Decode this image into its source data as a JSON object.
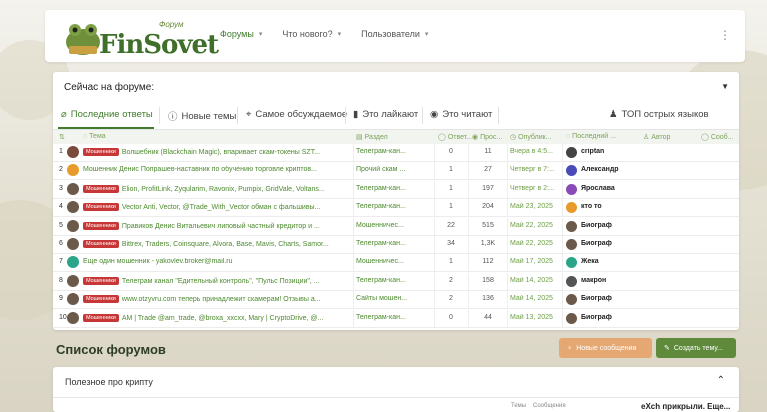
{
  "header": {
    "logo_text": "FinSovet",
    "logo_sub": "Форум",
    "nav": [
      {
        "label": "Форумы",
        "active": true
      },
      {
        "label": "Что нового?",
        "active": false
      },
      {
        "label": "Пользователи",
        "active": false
      }
    ],
    "menu_icon": "kebab-icon"
  },
  "now_on_forum": {
    "title": "Сейчас на форуме:",
    "tabs": [
      {
        "label": "Последние ответы",
        "icon": "reply-icon"
      },
      {
        "label": "Новые темы",
        "icon": "info-icon"
      },
      {
        "label": "Самое обсуждаемое",
        "icon": "megaphone-icon"
      },
      {
        "label": "Это лайкают",
        "icon": "like-icon"
      },
      {
        "label": "Это читают",
        "icon": "eye-icon"
      },
      {
        "label": "ТОП острых языков",
        "icon": "users-icon"
      }
    ],
    "columns": {
      "topic": "Тема",
      "section": "Раздел",
      "replies": "Ответ...",
      "views": "Прос...",
      "published": "Опублик...",
      "last": "Последний ...",
      "author": "Автор",
      "messages": "Сооб..."
    },
    "tag_label": "Мошенники",
    "rows": [
      {
        "n": "1",
        "tag": true,
        "title": "Волшебник (Blackchain Magic), впаривает скам-токены SZT...",
        "section": "Телеграм-кан...",
        "replies": "0",
        "views": "11",
        "pub": "Вчера в 4:5...",
        "last": "criptan",
        "ava": "#7a4a3a",
        "lava": "#444"
      },
      {
        "n": "2",
        "tag": false,
        "title": "Мошенник Денис Попрашев-наставник по обучению торговле криптов...",
        "section": "Прочий скам ...",
        "replies": "1",
        "views": "27",
        "pub": "Четверг в 7:...",
        "last": "Александр",
        "ava": "#e89b2b",
        "lava": "#4a4ab8"
      },
      {
        "n": "3",
        "tag": true,
        "title": "Elion, ProfitLink, Zyqularim, Ravonix, Pumpix, GridVale, Voltans...",
        "section": "Телеграм-кан...",
        "replies": "1",
        "views": "197",
        "pub": "Четверг в 2:...",
        "last": "Ярослава",
        "ava": "#6b5a4a",
        "lava": "#8a4ab8"
      },
      {
        "n": "4",
        "tag": true,
        "title": "Vector Anti, Vector, @Trade_With_Vector обман с фальшивы...",
        "section": "Телеграм-кан...",
        "replies": "1",
        "views": "204",
        "pub": "Май 23, 2025",
        "last": "кто то",
        "ava": "#6b5a4a",
        "lava": "#e89b2b"
      },
      {
        "n": "5",
        "tag": true,
        "title": "Правиков Денис Витальевич липовый частный кредитор и ...",
        "section": "Мошенничес...",
        "replies": "22",
        "views": "515",
        "pub": "Май 22, 2025",
        "last": "Биограф",
        "ava": "#6b5a4a",
        "lava": "#6b5a4a"
      },
      {
        "n": "6",
        "tag": true,
        "title": "Bittrex, Traders, Coinsquare, Alvora, Base, Mavis, Charts, Samor...",
        "section": "Телеграм-кан...",
        "replies": "34",
        "views": "1,3K",
        "pub": "Май 22, 2025",
        "last": "Биограф",
        "ava": "#6b5a4a",
        "lava": "#6b5a4a"
      },
      {
        "n": "7",
        "tag": false,
        "title": "Еще один мошенник - yakovlev.broker@mail.ru",
        "section": "Мошенничес...",
        "replies": "1",
        "views": "112",
        "pub": "Май 17, 2025",
        "last": "Жека",
        "ava": "#2aa58a",
        "lava": "#2aa58a"
      },
      {
        "n": "8",
        "tag": true,
        "title": "Телеграм канал \"Едительный контроль\", \"Пульс Позиции\", ...",
        "section": "Телеграм-кан...",
        "replies": "2",
        "views": "158",
        "pub": "Май 14, 2025",
        "last": "макрон",
        "ava": "#6b5a4a",
        "lava": "#555"
      },
      {
        "n": "9",
        "tag": true,
        "title": "www.otzyvru.com теперь принадлежит скамерам! Отзывы а...",
        "section": "Сайты мошен...",
        "replies": "2",
        "views": "136",
        "pub": "Май 14, 2025",
        "last": "Биограф",
        "ava": "#6b5a4a",
        "lava": "#6b5a4a"
      },
      {
        "n": "10",
        "tag": true,
        "title": "AM | Trade @am_trade, @broxa_xxcxx, Mary | CryptoDrive, @...",
        "section": "Телеграм-кан...",
        "replies": "0",
        "views": "44",
        "pub": "Май 13, 2025",
        "last": "Биограф",
        "ava": "#6b5a4a",
        "lava": "#6b5a4a"
      }
    ]
  },
  "forum_list": {
    "title": "Список форумов",
    "new_messages": "Новые сообщения",
    "create_topic": "Создать тему...",
    "category": "Полезное про крипту",
    "mini_topics": "Темы",
    "mini_messages": "Сообщения",
    "mini_last": "eXch прикрыли. Еще..."
  }
}
